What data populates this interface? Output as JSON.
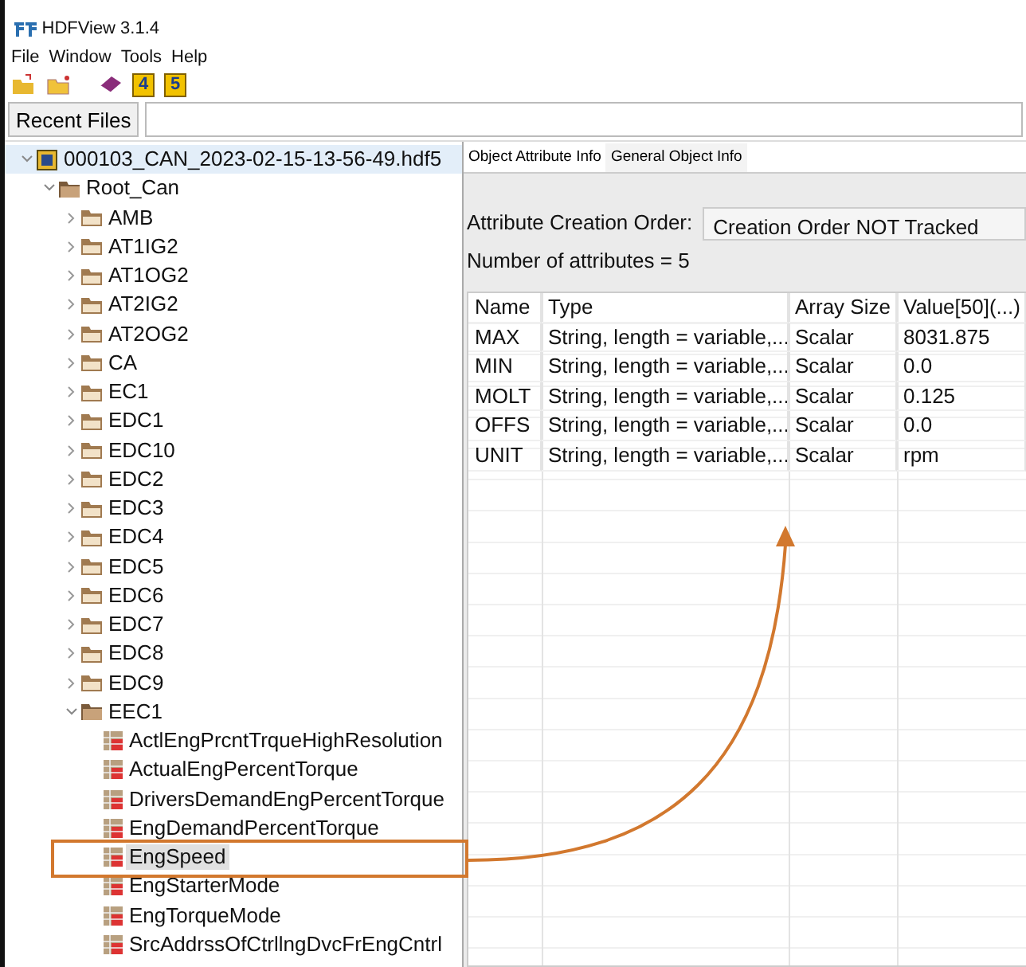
{
  "window": {
    "title": "HDFView 3.1.4"
  },
  "menu": [
    "File",
    "Window",
    "Tools",
    "Help"
  ],
  "toolbar": [
    {
      "kind": "open"
    },
    {
      "kind": "new"
    },
    {
      "kind": "book"
    },
    {
      "kind": "hdf",
      "label": "4"
    },
    {
      "kind": "hdf",
      "label": "5"
    }
  ],
  "recent_files": {
    "label": "Recent Files"
  },
  "tree": [
    {
      "label": "000103_CAN_2023-02-15-13-56-49.hdf5",
      "kind": "file",
      "expanded": true,
      "selected": false,
      "hovered": true,
      "children": [
        {
          "label": "Root_Can",
          "kind": "group",
          "expanded": true,
          "selected": false,
          "children": [
            {
              "label": "AMB",
              "kind": "group",
              "expanded": false,
              "selected": false
            },
            {
              "label": "AT1IG2",
              "kind": "group",
              "expanded": false,
              "selected": false
            },
            {
              "label": "AT1OG2",
              "kind": "group",
              "expanded": false,
              "selected": false
            },
            {
              "label": "AT2IG2",
              "kind": "group",
              "expanded": false,
              "selected": false
            },
            {
              "label": "AT2OG2",
              "kind": "group",
              "expanded": false,
              "selected": false
            },
            {
              "label": "CA",
              "kind": "group",
              "expanded": false,
              "selected": false
            },
            {
              "label": "EC1",
              "kind": "group",
              "expanded": false,
              "selected": false
            },
            {
              "label": "EDC1",
              "kind": "group",
              "expanded": false,
              "selected": false
            },
            {
              "label": "EDC10",
              "kind": "group",
              "expanded": false,
              "selected": false
            },
            {
              "label": "EDC2",
              "kind": "group",
              "expanded": false,
              "selected": false
            },
            {
              "label": "EDC3",
              "kind": "group",
              "expanded": false,
              "selected": false
            },
            {
              "label": "EDC4",
              "kind": "group",
              "expanded": false,
              "selected": false
            },
            {
              "label": "EDC5",
              "kind": "group",
              "expanded": false,
              "selected": false
            },
            {
              "label": "EDC6",
              "kind": "group",
              "expanded": false,
              "selected": false
            },
            {
              "label": "EDC7",
              "kind": "group",
              "expanded": false,
              "selected": false
            },
            {
              "label": "EDC8",
              "kind": "group",
              "expanded": false,
              "selected": false
            },
            {
              "label": "EDC9",
              "kind": "group",
              "expanded": false,
              "selected": false
            },
            {
              "label": "EEC1",
              "kind": "group",
              "expanded": true,
              "selected": false,
              "children": [
                {
                  "label": "ActlEngPrcntTrqueHighResolution",
                  "kind": "dataset",
                  "selected": false
                },
                {
                  "label": "ActualEngPercentTorque",
                  "kind": "dataset",
                  "selected": false
                },
                {
                  "label": "DriversDemandEngPercentTorque",
                  "kind": "dataset",
                  "selected": false
                },
                {
                  "label": "EngDemandPercentTorque",
                  "kind": "dataset",
                  "selected": false
                },
                {
                  "label": "EngSpeed",
                  "kind": "dataset",
                  "selected": true
                },
                {
                  "label": "EngStarterMode",
                  "kind": "dataset",
                  "selected": false
                },
                {
                  "label": "EngTorqueMode",
                  "kind": "dataset",
                  "selected": false
                },
                {
                  "label": "SrcAddrssOfCtrllngDvcFrEngCntrl",
                  "kind": "dataset",
                  "selected": false
                }
              ]
            }
          ]
        }
      ]
    }
  ],
  "tabs": [
    {
      "label": "Object Attribute Info",
      "selected": true
    },
    {
      "label": "General Object Info",
      "selected": false
    }
  ],
  "creation_order": {
    "label": "Attribute Creation Order:",
    "value": "Creation Order NOT Tracked"
  },
  "attribute_count": "Number of attributes = 5",
  "table": {
    "columns": [
      "Name",
      "Type",
      "Array Size",
      "Value[50](...)"
    ],
    "rows": [
      [
        "MAX",
        "String, length = variable,...",
        "Scalar",
        "8031.875"
      ],
      [
        "MIN",
        "String, length = variable,...",
        "Scalar",
        "0.0"
      ],
      [
        "MOLT",
        "String, length = variable,...",
        "Scalar",
        "0.125"
      ],
      [
        "OFFS",
        "String, length = variable,...",
        "Scalar",
        "0.0"
      ],
      [
        "UNIT",
        "String, length = variable,...",
        "Scalar",
        "rpm"
      ]
    ]
  }
}
